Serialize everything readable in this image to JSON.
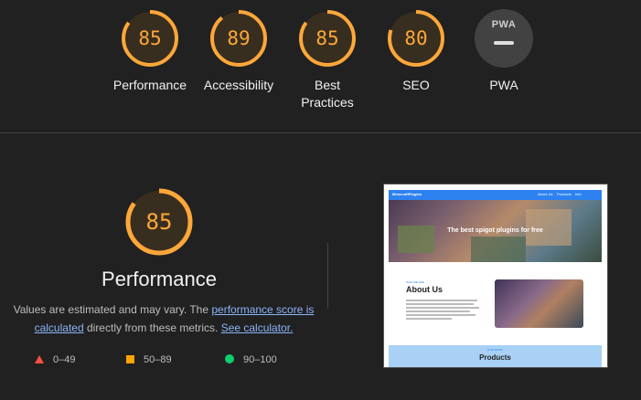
{
  "gauges": [
    {
      "score": "85",
      "label": "Performance",
      "value": 85
    },
    {
      "score": "89",
      "label": "Accessibility",
      "value": 89
    },
    {
      "score": "85",
      "label": "Best\nPractices",
      "value": 85
    },
    {
      "score": "80",
      "label": "SEO",
      "value": 80
    }
  ],
  "pwa": {
    "badge_text": "PWA",
    "label": "PWA"
  },
  "performance": {
    "score": "85",
    "value": 85,
    "title": "Performance",
    "desc_prefix": "Values are estimated and may vary. The ",
    "desc_link1": "performance score is calculated",
    "desc_middle": " directly from these metrics. ",
    "desc_link2": "See calculator."
  },
  "legend": [
    {
      "range": "0–49",
      "icon": "fail-triangle-icon",
      "color": "#ff4e42"
    },
    {
      "range": "50–89",
      "icon": "average-square-icon",
      "color": "#ffa400"
    },
    {
      "range": "90–100",
      "icon": "pass-circle-icon",
      "color": "#0cce6b"
    }
  ],
  "colors": {
    "average": "#ffa73a",
    "background": "#212121",
    "link": "#8ab4f8"
  },
  "screenshot": {
    "nav_brand": "MinecraftPlugins",
    "nav_links": [
      "About Us",
      "Products",
      "Info"
    ],
    "hero_tagline": "The best spigot plugins for free",
    "about_kicker": "WHO WE ARE",
    "about_title": "About Us",
    "products_kicker": "OUR WORK",
    "products_title": "Products"
  }
}
